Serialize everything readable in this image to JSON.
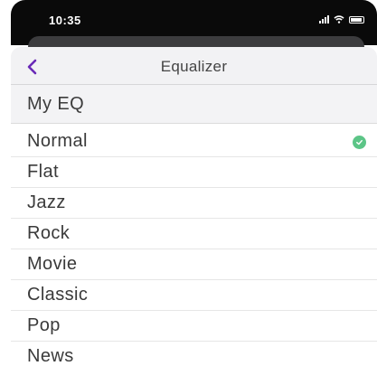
{
  "status_bar": {
    "time": "10:35"
  },
  "nav": {
    "title": "Equalizer",
    "back_icon": "chevron-left-icon",
    "accent_color": "#6a2ab7"
  },
  "my_eq": {
    "label": "My EQ"
  },
  "presets": [
    {
      "label": "Normal",
      "selected": true
    },
    {
      "label": "Flat",
      "selected": false
    },
    {
      "label": "Jazz",
      "selected": false
    },
    {
      "label": "Rock",
      "selected": false
    },
    {
      "label": "Movie",
      "selected": false
    },
    {
      "label": "Classic",
      "selected": false
    },
    {
      "label": "Pop",
      "selected": false
    },
    {
      "label": "News",
      "selected": false
    }
  ],
  "selected_indicator": {
    "icon": "checkmark-circle-icon",
    "color": "#5cc587"
  }
}
